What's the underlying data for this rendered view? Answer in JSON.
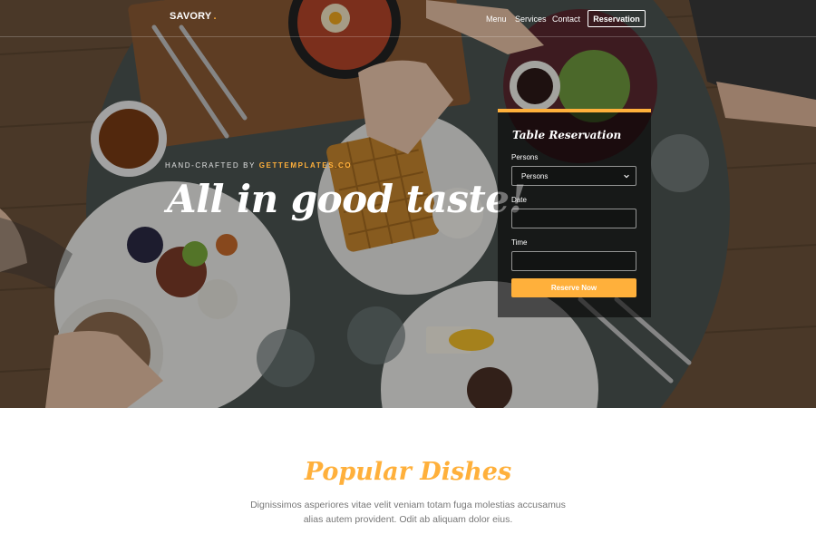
{
  "nav": {
    "brand": "SAVORY",
    "brand_dot": ".",
    "links": [
      "Menu",
      "Services",
      "Contact"
    ],
    "cta": "Reservation"
  },
  "hero": {
    "eyebrow_prefix": "HAND-CRAFTED BY",
    "eyebrow_link": "GETTEMPLATES.CO",
    "headline": "All in good taste!"
  },
  "reservation": {
    "title": "Table Reservation",
    "persons_label": "Persons",
    "persons_selected": "Persons",
    "date_label": "Date",
    "date_value": "",
    "time_label": "Time",
    "time_value": "",
    "submit_label": "Reserve Now"
  },
  "popular": {
    "title": "Popular Dishes",
    "description": "Dignissimos asperiores vitae velit veniam totam fuga molestias accusamus alias autem provident. Odit ab aliquam dolor eius."
  },
  "colors": {
    "accent": "#ffb03b",
    "muted_text": "#777777"
  }
}
